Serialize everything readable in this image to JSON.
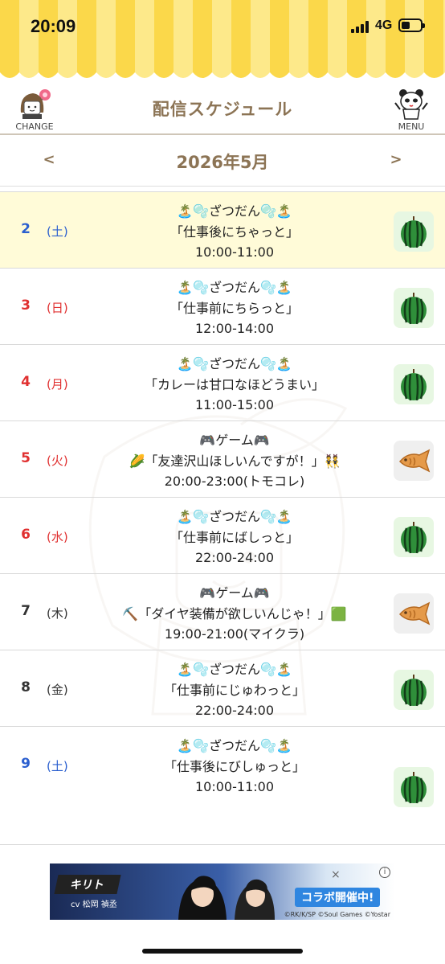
{
  "status": {
    "time": "20:09",
    "network": "4G"
  },
  "header": {
    "title": "配信スケジュール",
    "change_label": "CHANGE",
    "menu_label": "MENU"
  },
  "monthnav": {
    "prev": "<",
    "next": ">",
    "title": "2026年5月"
  },
  "rows": [
    {
      "day": "2",
      "dow": "(土)",
      "line1": "🏝️🫧ざつだん🫧🏝️",
      "line2": "「仕事後にちゃっと」",
      "line3": "10:00-11:00",
      "category": "watermelon"
    },
    {
      "day": "3",
      "dow": "(日)",
      "line1": "🏝️🫧ざつだん🫧🏝️",
      "line2": "「仕事前にちらっと」",
      "line3": "12:00-14:00",
      "category": "watermelon"
    },
    {
      "day": "4",
      "dow": "(月)",
      "line1": "🏝️🫧ざつだん🫧🏝️",
      "line2": "「カレーは甘口なほどうまい」",
      "line3": "11:00-15:00",
      "category": "watermelon"
    },
    {
      "day": "5",
      "dow": "(火)",
      "line1": "🎮ゲーム🎮",
      "line2": "🌽「友達沢山ほしいんですが！」👯",
      "line3": "20:00-23:00(トモコレ)",
      "category": "taiyaki"
    },
    {
      "day": "6",
      "dow": "(水)",
      "line1": "🏝️🫧ざつだん🫧🏝️",
      "line2": "「仕事前にばしっと」",
      "line3": "22:00-24:00",
      "category": "watermelon"
    },
    {
      "day": "7",
      "dow": "(木)",
      "line1": "🎮ゲーム🎮",
      "line2": "⛏️「ダイヤ装備が欲しいんじゃ！」🟩",
      "line3": "19:00-21:00(マイクラ)",
      "category": "taiyaki"
    },
    {
      "day": "8",
      "dow": "(金)",
      "line1": "🏝️🫧ざつだん🫧🏝️",
      "line2": "「仕事前にじゅわっと」",
      "line3": "22:00-24:00",
      "category": "watermelon"
    },
    {
      "day": "9",
      "dow": "(土)",
      "line1": "🏝️🫧ざつだん🫧🏝️",
      "line2": "「仕事後にびしゅっと」",
      "line3": "10:00-11:00",
      "category": "watermelon"
    }
  ],
  "ad": {
    "name": "キリト",
    "cv": "cv 松岡 禎丞",
    "collab": "コラボ開催中!",
    "info": "i",
    "x": "×",
    "copyright": "©RK/K/SP ©Soul Games ©Yostar"
  },
  "colors": {
    "accent": "#8c7455",
    "awning": "#fbd84a",
    "today_bg": "#fffbd8",
    "saturday": "#2b5fcf",
    "holiday": "#e03030"
  }
}
